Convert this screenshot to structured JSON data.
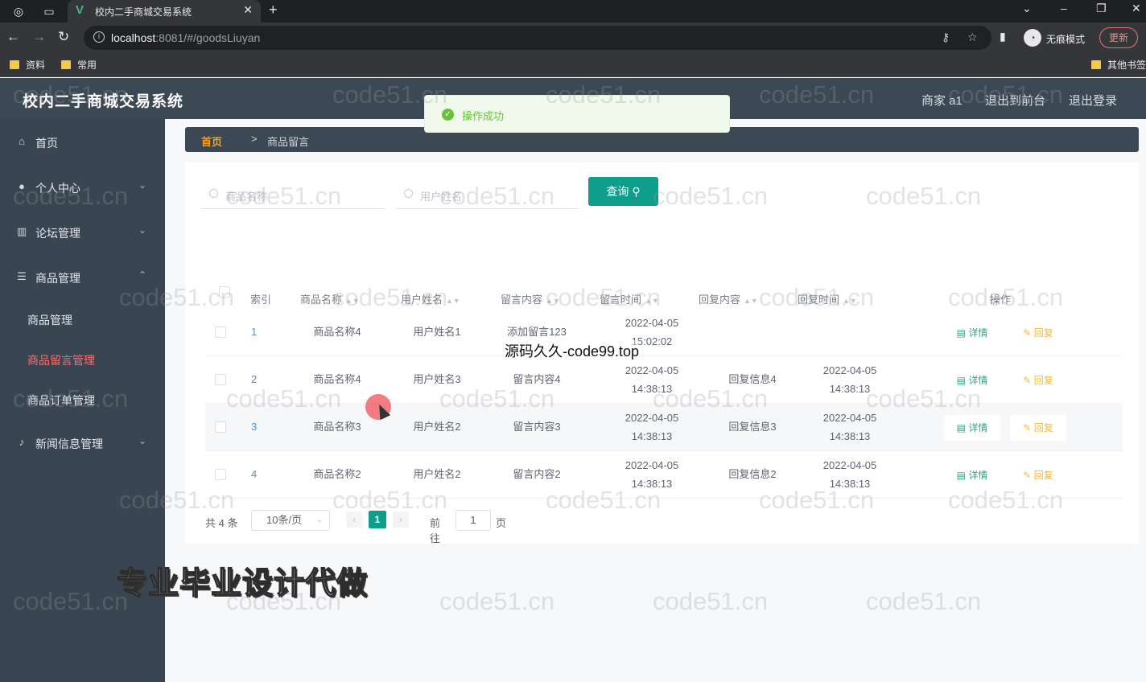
{
  "browser": {
    "tab_title": "校内二手商城交易系统",
    "url_host": "localhost",
    "url_path": ":8081/#/goodsLiuyan",
    "incognito_label": "无痕模式",
    "update_label": "更新",
    "bookmarks": [
      "资料",
      "常用"
    ],
    "other_bookmarks": "其他书签"
  },
  "header": {
    "title": "校内二手商城交易系统",
    "user": "商家 a1",
    "front_link": "退出到前台",
    "logout_link": "退出登录"
  },
  "toast": {
    "message": "操作成功"
  },
  "sidebar": {
    "items": [
      {
        "label": "首页",
        "icon": "home-icon"
      },
      {
        "label": "个人中心",
        "icon": "user-icon"
      },
      {
        "label": "论坛管理",
        "icon": "chart-icon"
      },
      {
        "label": "商品管理",
        "icon": "sliders-icon"
      },
      {
        "label": "新闻信息管理",
        "icon": "mic-icon"
      }
    ],
    "sub_items": [
      "商品管理",
      "商品留言管理",
      "商品订单管理"
    ],
    "active_sub": "商品留言管理"
  },
  "breadcrumb": {
    "home": "首页",
    "separator": ">",
    "current": "商品留言"
  },
  "search": {
    "goods_placeholder": "商品名称",
    "user_placeholder": "用户姓名",
    "query_label": "查询"
  },
  "table": {
    "headers": [
      "索引",
      "商品名称",
      "用户姓名",
      "留言内容",
      "留言时间",
      "回复内容",
      "回复时间",
      "操作"
    ],
    "rows": [
      {
        "index": "1",
        "goods": "商品名称4",
        "user": "用户姓名1",
        "content": "添加留言123",
        "time": "2022-04-05 15:02:02",
        "reply": "",
        "reply_time": ""
      },
      {
        "index": "2",
        "goods": "商品名称4",
        "user": "用户姓名3",
        "content": "留言内容4",
        "time": "2022-04-05 14:38:13",
        "reply": "回复信息4",
        "reply_time": "2022-04-05 14:38:13"
      },
      {
        "index": "3",
        "goods": "商品名称3",
        "user": "用户姓名2",
        "content": "留言内容3",
        "time": "2022-04-05 14:38:13",
        "reply": "回复信息3",
        "reply_time": "2022-04-05 14:38:13"
      },
      {
        "index": "4",
        "goods": "商品名称2",
        "user": "用户姓名2",
        "content": "留言内容2",
        "time": "2022-04-05 14:38:13",
        "reply": "回复信息2",
        "reply_time": "2022-04-05 14:38:13"
      }
    ],
    "detail_label": "详情",
    "reply_label": "回复"
  },
  "pagination": {
    "total": "共 4 条",
    "page_size": "10条/页",
    "current_page": "1",
    "goto_label": "前往",
    "goto_value": "1",
    "page_unit": "页"
  },
  "overlay": {
    "watermark": "code51.cn",
    "promo": "专业毕业设计代做",
    "site_tag": "源码久久-code99.top"
  }
}
